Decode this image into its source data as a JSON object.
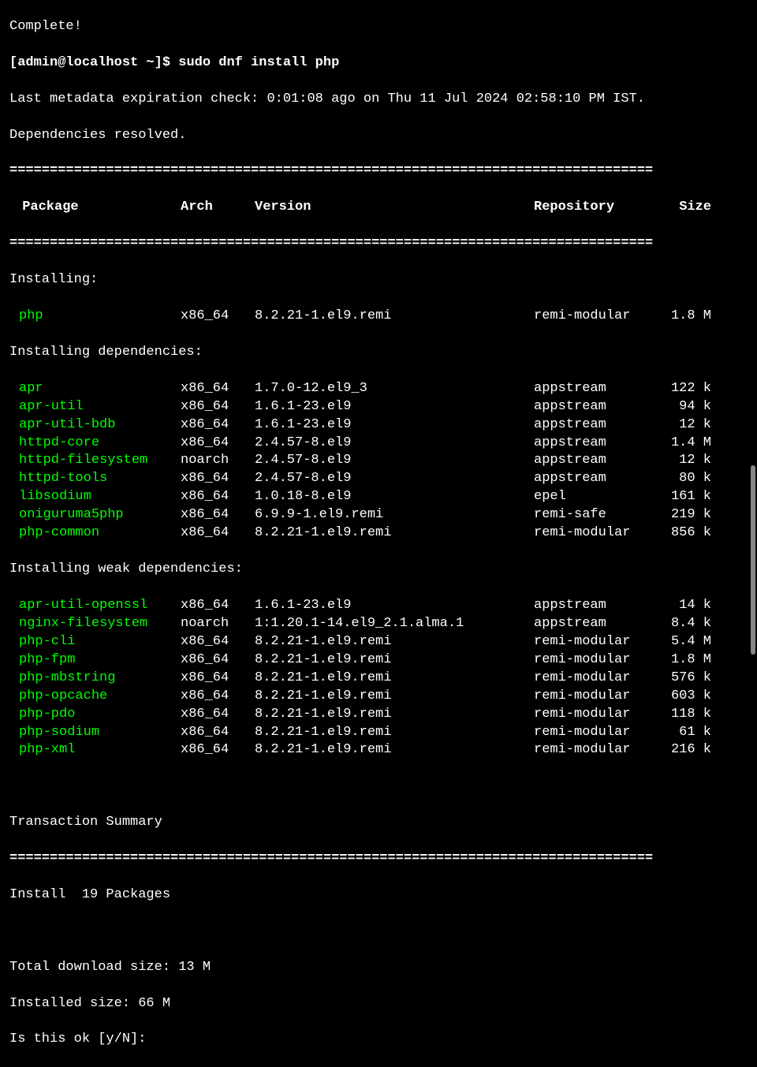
{
  "truncated_top": "Complete!",
  "prompt": "[admin@localhost ~]$ ",
  "command": "sudo dnf install php",
  "metadata_line": "Last metadata expiration check: 0:01:08 ago on Thu 11 Jul 2024 02:58:10 PM IST.",
  "deps_resolved": "Dependencies resolved.",
  "divider": "================================================================================",
  "headers": {
    "package": " Package",
    "arch": "Arch",
    "version": "Version",
    "repository": "Repository",
    "size": "Size"
  },
  "section_installing": "Installing:",
  "section_deps": "Installing dependencies:",
  "section_weak": "Installing weak dependencies:",
  "installing": [
    {
      "name": "php",
      "arch": "x86_64",
      "version": "8.2.21-1.el9.remi",
      "repo": "remi-modular",
      "size": "1.8 M"
    }
  ],
  "deps": [
    {
      "name": "apr",
      "arch": "x86_64",
      "version": "1.7.0-12.el9_3",
      "repo": "appstream",
      "size": "122 k"
    },
    {
      "name": "apr-util",
      "arch": "x86_64",
      "version": "1.6.1-23.el9",
      "repo": "appstream",
      "size": " 94 k"
    },
    {
      "name": "apr-util-bdb",
      "arch": "x86_64",
      "version": "1.6.1-23.el9",
      "repo": "appstream",
      "size": " 12 k"
    },
    {
      "name": "httpd-core",
      "arch": "x86_64",
      "version": "2.4.57-8.el9",
      "repo": "appstream",
      "size": "1.4 M"
    },
    {
      "name": "httpd-filesystem",
      "arch": "noarch",
      "version": "2.4.57-8.el9",
      "repo": "appstream",
      "size": " 12 k"
    },
    {
      "name": "httpd-tools",
      "arch": "x86_64",
      "version": "2.4.57-8.el9",
      "repo": "appstream",
      "size": " 80 k"
    },
    {
      "name": "libsodium",
      "arch": "x86_64",
      "version": "1.0.18-8.el9",
      "repo": "epel",
      "size": "161 k"
    },
    {
      "name": "oniguruma5php",
      "arch": "x86_64",
      "version": "6.9.9-1.el9.remi",
      "repo": "remi-safe",
      "size": "219 k"
    },
    {
      "name": "php-common",
      "arch": "x86_64",
      "version": "8.2.21-1.el9.remi",
      "repo": "remi-modular",
      "size": "856 k"
    }
  ],
  "weak": [
    {
      "name": "apr-util-openssl",
      "arch": "x86_64",
      "version": "1.6.1-23.el9",
      "repo": "appstream",
      "size": " 14 k"
    },
    {
      "name": "nginx-filesystem",
      "arch": "noarch",
      "version": "1:1.20.1-14.el9_2.1.alma.1",
      "repo": "appstream",
      "size": "8.4 k"
    },
    {
      "name": "php-cli",
      "arch": "x86_64",
      "version": "8.2.21-1.el9.remi",
      "repo": "remi-modular",
      "size": "5.4 M"
    },
    {
      "name": "php-fpm",
      "arch": "x86_64",
      "version": "8.2.21-1.el9.remi",
      "repo": "remi-modular",
      "size": "1.8 M"
    },
    {
      "name": "php-mbstring",
      "arch": "x86_64",
      "version": "8.2.21-1.el9.remi",
      "repo": "remi-modular",
      "size": "576 k"
    },
    {
      "name": "php-opcache",
      "arch": "x86_64",
      "version": "8.2.21-1.el9.remi",
      "repo": "remi-modular",
      "size": "603 k"
    },
    {
      "name": "php-pdo",
      "arch": "x86_64",
      "version": "8.2.21-1.el9.remi",
      "repo": "remi-modular",
      "size": "118 k"
    },
    {
      "name": "php-sodium",
      "arch": "x86_64",
      "version": "8.2.21-1.el9.remi",
      "repo": "remi-modular",
      "size": " 61 k"
    },
    {
      "name": "php-xml",
      "arch": "x86_64",
      "version": "8.2.21-1.el9.remi",
      "repo": "remi-modular",
      "size": "216 k"
    }
  ],
  "transaction_summary": "Transaction Summary",
  "install_count": "Install  19 Packages",
  "download_size": "Total download size: 13 M",
  "installed_size": "Installed size: 66 M",
  "confirm_prompt": "Is this ok [y/N]: "
}
